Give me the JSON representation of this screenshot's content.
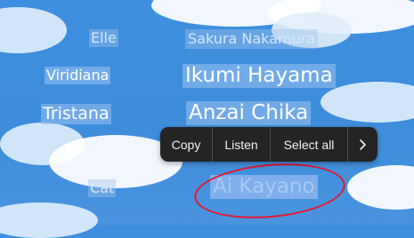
{
  "rows": [
    {
      "name": "Elle",
      "title": "Sakura Nakamura"
    },
    {
      "name": "Viridiana",
      "title": "Ikumi Hayama"
    },
    {
      "name": "Tristana",
      "title": "Anzai Chika"
    },
    {
      "name": "Cat",
      "title": "Ai Kayano"
    }
  ],
  "context_menu": {
    "items": [
      "Copy",
      "Listen",
      "Select all"
    ],
    "more_icon": "chevron-right-icon"
  },
  "colors": {
    "sky": "#3f8fe0",
    "selection": "#9bc0ee",
    "menu_background": "#242424",
    "annotation": "#e2192a"
  }
}
